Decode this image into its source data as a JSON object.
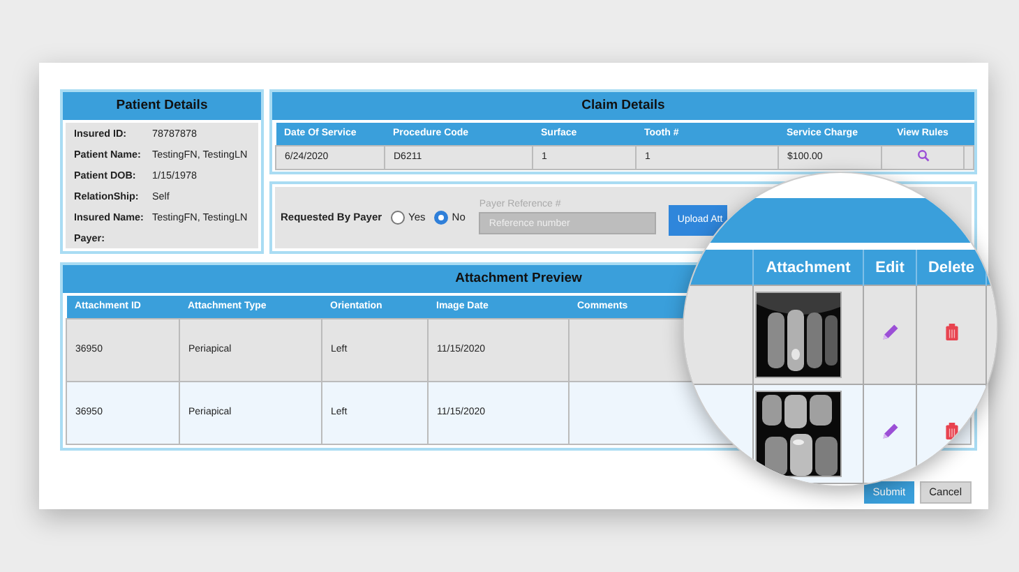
{
  "patient_details": {
    "title": "Patient Details",
    "fields": [
      {
        "label": "Insured ID:",
        "value": "78787878"
      },
      {
        "label": "Patient Name:",
        "value": "TestingFN, TestingLN"
      },
      {
        "label": "Patient DOB:",
        "value": "1/15/1978"
      },
      {
        "label": "RelationShip:",
        "value": "Self"
      },
      {
        "label": "Insured Name:",
        "value": "TestingFN, TestingLN"
      },
      {
        "label": "Payer:"
      }
    ]
  },
  "claim_details": {
    "title": "Claim Details",
    "columns": [
      "Date Of Service",
      "Procedure Code",
      "Surface",
      "Tooth #",
      "Service Charge",
      "View Rules"
    ],
    "rows": [
      [
        "6/24/2020",
        "D6211",
        "1",
        "1",
        "$100.00"
      ]
    ]
  },
  "request": {
    "label": "Requested By Payer",
    "options": [
      {
        "label": "Yes",
        "selected": false
      },
      {
        "label": "No",
        "selected": true
      }
    ],
    "reference": {
      "label": "Payer Reference #",
      "placeholder": "Reference number"
    },
    "upload_button": "Upload Att"
  },
  "attachment_preview": {
    "title": "Attachment Preview",
    "columns": [
      "Attachment ID",
      "Attachment Type",
      "Orientation",
      "Image Date",
      "Comments"
    ],
    "rows": [
      [
        "36950",
        "Periapical",
        "Left",
        "11/15/2020"
      ],
      [
        "36950",
        "Periapical",
        "Left",
        "11/15/2020"
      ]
    ]
  },
  "magnifier": {
    "columns": [
      "Attachment",
      "Edit",
      "Delete"
    ],
    "rows": [
      {
        "kind": "picture"
      },
      {
        "kind": "picture"
      }
    ]
  },
  "buttons": [
    {
      "label": "Submit",
      "kind": "primary"
    },
    {
      "label": "Cancel",
      "kind": "secondary"
    }
  ]
}
